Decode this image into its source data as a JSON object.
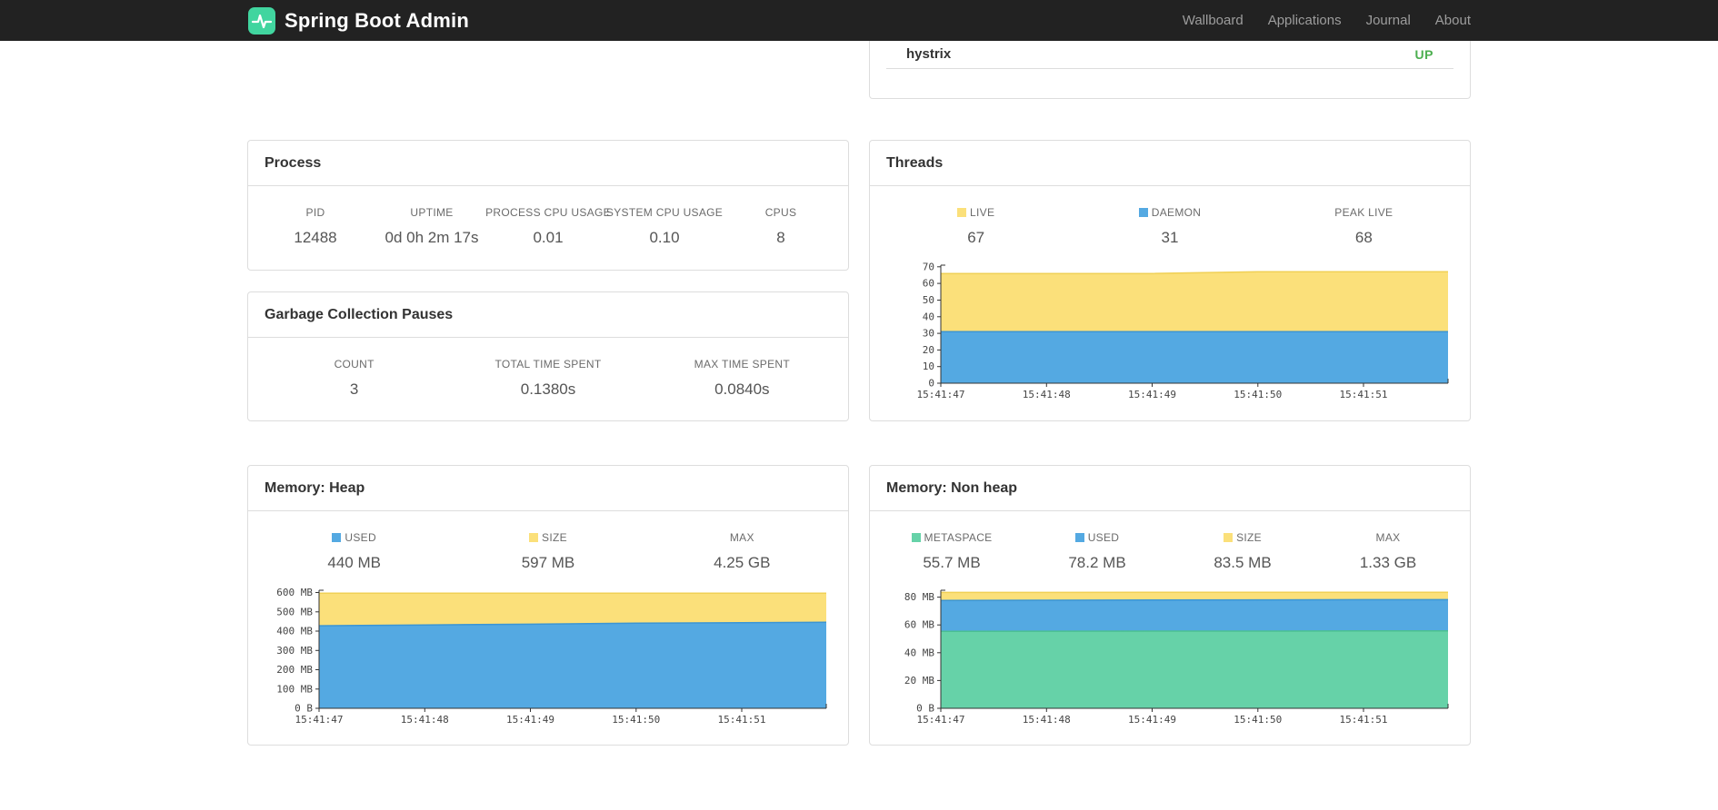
{
  "colors": {
    "yellow": "#fbe07a",
    "blue": "#54a9e2",
    "green": "#66d2a8",
    "status_up": "#4caf50",
    "navbar_bg": "#222222"
  },
  "navbar": {
    "brand": "Spring Boot Admin",
    "links": [
      {
        "label": "Wallboard"
      },
      {
        "label": "Applications"
      },
      {
        "label": "Journal"
      },
      {
        "label": "About"
      }
    ]
  },
  "health_panel": {
    "service": "hystrix",
    "status": "UP"
  },
  "panels": {
    "process": {
      "title": "Process",
      "stats": [
        {
          "label": "PID",
          "value": "12488"
        },
        {
          "label": "UPTIME",
          "value": "0d 0h 2m 17s"
        },
        {
          "label": "PROCESS CPU USAGE",
          "value": "0.01"
        },
        {
          "label": "SYSTEM CPU USAGE",
          "value": "0.10"
        },
        {
          "label": "CPUS",
          "value": "8"
        }
      ]
    },
    "gc": {
      "title": "Garbage Collection Pauses",
      "stats": [
        {
          "label": "COUNT",
          "value": "3"
        },
        {
          "label": "TOTAL TIME SPENT",
          "value": "0.1380s"
        },
        {
          "label": "MAX TIME SPENT",
          "value": "0.0840s"
        }
      ]
    },
    "threads": {
      "title": "Threads",
      "stats": [
        {
          "label": "LIVE",
          "value": "67",
          "swatch": "yellow"
        },
        {
          "label": "DAEMON",
          "value": "31",
          "swatch": "blue"
        },
        {
          "label": "PEAK LIVE",
          "value": "68"
        }
      ]
    },
    "heap": {
      "title": "Memory: Heap",
      "stats": [
        {
          "label": "USED",
          "value": "440 MB",
          "swatch": "blue"
        },
        {
          "label": "SIZE",
          "value": "597 MB",
          "swatch": "yellow"
        },
        {
          "label": "MAX",
          "value": "4.25 GB"
        }
      ]
    },
    "nonheap": {
      "title": "Memory: Non heap",
      "stats": [
        {
          "label": "METASPACE",
          "value": "55.7 MB",
          "swatch": "green"
        },
        {
          "label": "USED",
          "value": "78.2 MB",
          "swatch": "blue"
        },
        {
          "label": "SIZE",
          "value": "83.5 MB",
          "swatch": "yellow"
        },
        {
          "label": "MAX",
          "value": "1.33 GB"
        }
      ]
    }
  },
  "chart_data": [
    {
      "id": "threads",
      "type": "area",
      "title": "Threads",
      "x_domain": [
        47,
        51.8
      ],
      "x_points": [
        47,
        48,
        49,
        50,
        51,
        51.8
      ],
      "x_ticks": [
        {
          "v": 47,
          "label": "15:41:47"
        },
        {
          "v": 48,
          "label": "15:41:48"
        },
        {
          "v": 49,
          "label": "15:41:49"
        },
        {
          "v": 50,
          "label": "15:41:50"
        },
        {
          "v": 51,
          "label": "15:41:51"
        }
      ],
      "ylim": [
        0,
        71
      ],
      "y_ticks": [
        {
          "v": 0,
          "label": "0"
        },
        {
          "v": 10,
          "label": "10"
        },
        {
          "v": 20,
          "label": "20"
        },
        {
          "v": 30,
          "label": "30"
        },
        {
          "v": 40,
          "label": "40"
        },
        {
          "v": 50,
          "label": "50"
        },
        {
          "v": 60,
          "label": "60"
        },
        {
          "v": 70,
          "label": "70"
        }
      ],
      "series": [
        {
          "name": "LIVE",
          "fill": "#fbe07a",
          "stroke": "#f0d055",
          "values": [
            66,
            66,
            66,
            67,
            67,
            67
          ]
        },
        {
          "name": "DAEMON",
          "fill": "#54a9e2",
          "stroke": "#3b95d4",
          "values": [
            31,
            31,
            31,
            31,
            31,
            31
          ]
        }
      ]
    },
    {
      "id": "heap",
      "type": "area",
      "title": "Memory: Heap",
      "x_domain": [
        47,
        51.8
      ],
      "x_points": [
        47,
        48,
        49,
        50,
        51,
        51.8
      ],
      "x_ticks": [
        {
          "v": 47,
          "label": "15:41:47"
        },
        {
          "v": 48,
          "label": "15:41:48"
        },
        {
          "v": 49,
          "label": "15:41:49"
        },
        {
          "v": 50,
          "label": "15:41:50"
        },
        {
          "v": 51,
          "label": "15:41:51"
        }
      ],
      "ylim": [
        0,
        612
      ],
      "y_ticks": [
        {
          "v": 0,
          "label": "0 B"
        },
        {
          "v": 100,
          "label": "100 MB"
        },
        {
          "v": 200,
          "label": "200 MB"
        },
        {
          "v": 300,
          "label": "300 MB"
        },
        {
          "v": 400,
          "label": "400 MB"
        },
        {
          "v": 500,
          "label": "500 MB"
        },
        {
          "v": 600,
          "label": "600 MB"
        }
      ],
      "series": [
        {
          "name": "SIZE",
          "fill": "#fbe07a",
          "stroke": "#f0d055",
          "values": [
            597,
            597,
            597,
            597,
            597,
            597
          ]
        },
        {
          "name": "USED",
          "fill": "#54a9e2",
          "stroke": "#3b95d4",
          "values": [
            428,
            432,
            436,
            441,
            444,
            446
          ]
        }
      ]
    },
    {
      "id": "nonheap",
      "type": "area",
      "title": "Memory: Non heap",
      "x_domain": [
        47,
        51.8
      ],
      "x_points": [
        47,
        48,
        49,
        50,
        51,
        51.8
      ],
      "x_ticks": [
        {
          "v": 47,
          "label": "15:41:47"
        },
        {
          "v": 48,
          "label": "15:41:48"
        },
        {
          "v": 49,
          "label": "15:41:49"
        },
        {
          "v": 50,
          "label": "15:41:50"
        },
        {
          "v": 51,
          "label": "15:41:51"
        }
      ],
      "ylim": [
        0,
        85
      ],
      "y_ticks": [
        {
          "v": 0,
          "label": "0 B"
        },
        {
          "v": 20,
          "label": "20 MB"
        },
        {
          "v": 40,
          "label": "40 MB"
        },
        {
          "v": 60,
          "label": "60 MB"
        },
        {
          "v": 80,
          "label": "80 MB"
        }
      ],
      "series": [
        {
          "name": "SIZE",
          "fill": "#fbe07a",
          "stroke": "#f0d055",
          "values": [
            83.4,
            83.4,
            83.5,
            83.5,
            83.5,
            83.5
          ]
        },
        {
          "name": "USED",
          "fill": "#54a9e2",
          "stroke": "#3b95d4",
          "values": [
            77.6,
            77.8,
            78.0,
            78.1,
            78.2,
            78.2
          ]
        },
        {
          "name": "METASPACE",
          "fill": "#66d2a8",
          "stroke": "#4bbf92",
          "values": [
            55.4,
            55.5,
            55.6,
            55.6,
            55.7,
            55.7
          ]
        }
      ]
    }
  ]
}
